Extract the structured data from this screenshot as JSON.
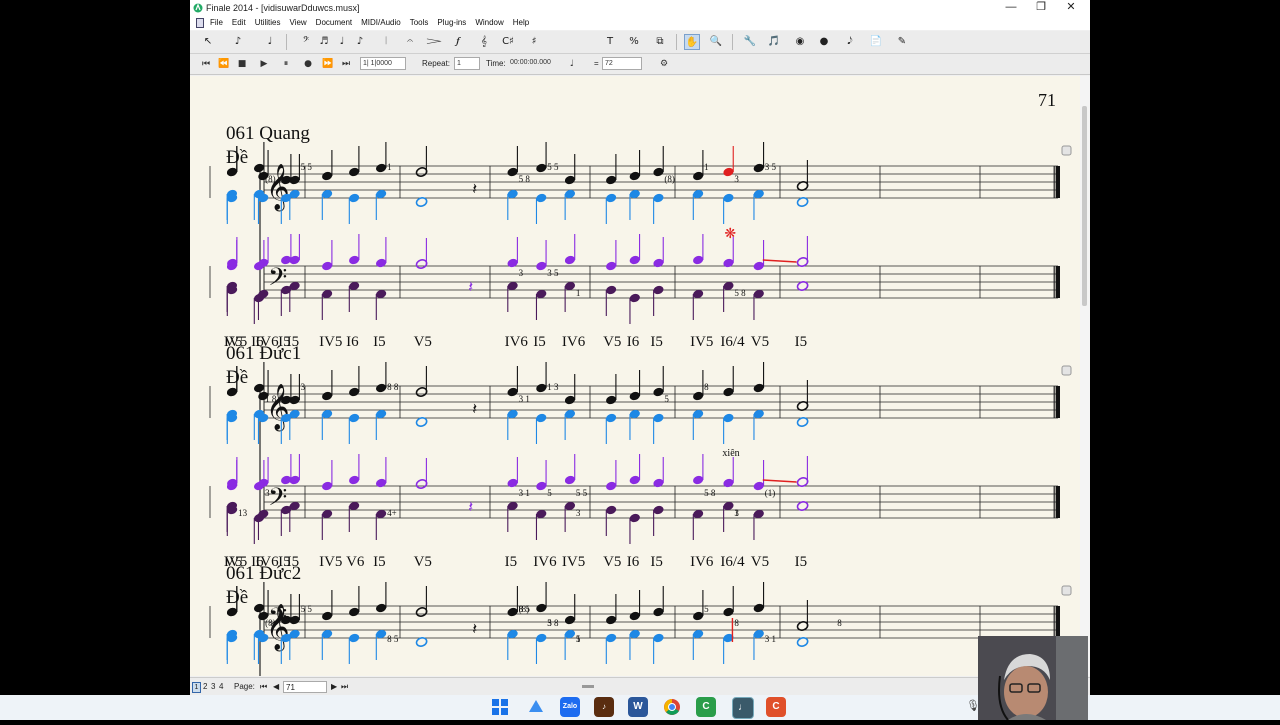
{
  "window": {
    "title": "Finale 2014 - [vidisuwarDduwcs.musx]",
    "minimize": "—",
    "maximize": "❐",
    "close": "✕"
  },
  "menu": [
    "File",
    "Edit",
    "Utilities",
    "View",
    "Document",
    "MIDI/Audio",
    "Tools",
    "Plug-ins",
    "Window",
    "Help"
  ],
  "toolbar": {
    "glyphs": [
      "↖",
      "♪",
      "♩",
      "𝄢",
      "♬",
      "♩",
      "♪",
      "𝄀",
      "𝄐",
      "𝆓",
      "𝆑",
      "𝄞",
      "C♯",
      "♯",
      "T",
      "%",
      "⧉",
      "✋",
      "🔍",
      "🔧",
      "🎵",
      "◉",
      "●",
      "𝅘𝅥𝅮",
      "📄",
      "✎"
    ]
  },
  "playback": {
    "measure_field": "1| 1|0000",
    "repeat_label": "Repeat:",
    "repeat_value": "1",
    "time_label": "Time:",
    "time_value": "00:00:00.000",
    "equals": "=",
    "tempo": "72"
  },
  "score": {
    "page_number": "71",
    "systems": [
      {
        "title": "061 Quang",
        "sub": "Đề",
        "chords": [
          "I5",
          "IV6",
          "IV5",
          "V5",
          "I6",
          "I5",
          "IV5",
          "I6",
          "I5",
          "V5",
          "IV6",
          "I5",
          "IV6",
          "V5",
          "I6",
          "I5",
          "IV5",
          "I6/4",
          "V5",
          "I5"
        ],
        "upper_marks": [
          "5 5",
          "(8)",
          "1",
          "5 8",
          "5 5",
          "(8)",
          "1",
          "3",
          "3 5"
        ],
        "lower_marks": [
          "3 5",
          "1",
          "3",
          "5 8"
        ],
        "star": "❋"
      },
      {
        "title": "061 Đức1",
        "sub": "Đề",
        "chords": [
          "I5",
          "IV6",
          "IV5",
          "V5",
          "I6",
          "I5",
          "IV5",
          "V6",
          "I5",
          "V5",
          "I5",
          "IV6",
          "IV5",
          "V5",
          "I6",
          "I5",
          "IV6",
          "I6/4",
          "V5",
          "I5"
        ],
        "upper_marks": [
          "3",
          "1 8 5",
          "8 8",
          "3 1",
          "1 3",
          "5",
          "8"
        ],
        "lower_marks": [
          "5",
          "3",
          "3 1",
          "1",
          "5 5",
          "13",
          "3",
          "4+",
          "5 8",
          "3",
          "(1)"
        ],
        "annotation": "xiên"
      },
      {
        "title": "061 Đức2",
        "sub": "Đề",
        "upper_marks": [
          "5 5",
          "(8)",
          "8 5",
          "8",
          "5 8",
          "5",
          "(8)",
          "3",
          "1",
          "8 5",
          "8",
          "3 1",
          "5",
          "8"
        ]
      }
    ]
  },
  "status": {
    "pages": [
      "1",
      "2",
      "3",
      "4"
    ],
    "page_label": "Page:",
    "page_value": "71"
  },
  "taskbar": {
    "icons": [
      "windows-icon",
      "search-icon",
      "zalo-icon",
      "musescore-icon",
      "word-icon",
      "chrome-icon",
      "camtasia-icon",
      "finale-icon",
      "app-icon"
    ],
    "zalo": "Zalo",
    "word": "W"
  },
  "colors": {
    "black_note": "#111111",
    "blue_note": "#1e88e5",
    "purple_note": "#8a2be2",
    "red_note": "#e02020",
    "paper": "#f8f5ea"
  }
}
